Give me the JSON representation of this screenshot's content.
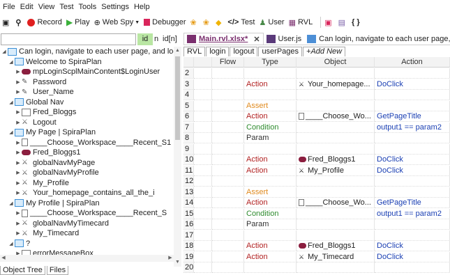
{
  "menu": [
    "File",
    "Edit",
    "View",
    "Test",
    "Tools",
    "Settings",
    "Help"
  ],
  "toolbar": {
    "record": "Record",
    "play": "Play",
    "webspy": "Web Spy",
    "debugger": "Debugger",
    "test": "Test",
    "user": "User",
    "rvl": "RVL",
    "braces": "{ }"
  },
  "left": {
    "search_value": "",
    "id_label": "id",
    "n_label": "n",
    "idn_label": "id[n]",
    "tabs": [
      "Object Tree",
      "Files"
    ]
  },
  "tree": [
    {
      "label": "Can login, navigate to each user page, and log",
      "indent": 0,
      "icon": "folder"
    },
    {
      "label": "Welcome to SpiraPlan",
      "indent": 1,
      "icon": "folder"
    },
    {
      "label": "mpLoginScplMainContent$LoginUser",
      "indent": 2,
      "icon": "pill"
    },
    {
      "label": "Password",
      "indent": 2,
      "icon": "edit"
    },
    {
      "label": "User_Name",
      "indent": 2,
      "icon": "edit"
    },
    {
      "label": "Global Nav",
      "indent": 1,
      "icon": "folder"
    },
    {
      "label": "Fred_Bloggs",
      "indent": 2,
      "icon": "table"
    },
    {
      "label": "Logout",
      "indent": 2,
      "icon": "link"
    },
    {
      "label": "My Page | SpiraPlan",
      "indent": 1,
      "icon": "folder"
    },
    {
      "label": "____Choose_Workspace____Recent_S1",
      "indent": 2,
      "icon": "doc"
    },
    {
      "label": "Fred_Bloggs1",
      "indent": 2,
      "icon": "pill"
    },
    {
      "label": "globalNavMyPage",
      "indent": 2,
      "icon": "link"
    },
    {
      "label": "globalNavMyProfile",
      "indent": 2,
      "icon": "link"
    },
    {
      "label": "My_Profile",
      "indent": 2,
      "icon": "link"
    },
    {
      "label": "Your_homepage_contains_all_the_i",
      "indent": 2,
      "icon": "link"
    },
    {
      "label": "My Profile | SpiraPlan",
      "indent": 1,
      "icon": "folder"
    },
    {
      "label": "____Choose_Workspace____Recent_S",
      "indent": 2,
      "icon": "doc"
    },
    {
      "label": "globalNavMyTimecard",
      "indent": 2,
      "icon": "link"
    },
    {
      "label": "My_Timecard",
      "indent": 2,
      "icon": "link"
    },
    {
      "label": "?",
      "indent": 1,
      "icon": "folder"
    },
    {
      "label": "errorMessageBox",
      "indent": 2,
      "icon": "table"
    }
  ],
  "doc_tabs": [
    {
      "label": "Main.rvl.xlsx*",
      "active": true,
      "icon": "xl"
    },
    {
      "label": "User.js",
      "active": false,
      "icon": "js"
    },
    {
      "label": "Can login, navigate to each user page, and lo",
      "active": false,
      "icon": "rvl"
    }
  ],
  "sheet_tabs": [
    "RVL",
    "login",
    "logout",
    "userPages",
    "+Add New"
  ],
  "columns": [
    "Flow",
    "Type",
    "Object",
    "Action"
  ],
  "rows": [
    {
      "n": "2",
      "type": "",
      "object": "",
      "action": ""
    },
    {
      "n": "3",
      "type": "Action",
      "object": "Your_homepage...",
      "action": "DoClick"
    },
    {
      "n": "4",
      "type": "",
      "object": "",
      "action": ""
    },
    {
      "n": "5",
      "type": "Assert",
      "object": "",
      "action": ""
    },
    {
      "n": "6",
      "type": "Action",
      "object": "____Choose_Wo...",
      "action": "GetPageTitle"
    },
    {
      "n": "7",
      "type": "Condition",
      "object": "",
      "action": "output1 == param2"
    },
    {
      "n": "8",
      "type": "Param",
      "object": "",
      "action": ""
    },
    {
      "n": "9",
      "type": "",
      "object": "",
      "action": ""
    },
    {
      "n": "10",
      "type": "Action",
      "object": "Fred_Bloggs1",
      "action": "DoClick"
    },
    {
      "n": "11",
      "type": "Action",
      "object": "My_Profile",
      "action": "DoClick"
    },
    {
      "n": "12",
      "type": "",
      "object": "",
      "action": ""
    },
    {
      "n": "13",
      "type": "Assert",
      "object": "",
      "action": ""
    },
    {
      "n": "14",
      "type": "Action",
      "object": "____Choose_Wo...",
      "action": "GetPageTitle"
    },
    {
      "n": "15",
      "type": "Condition",
      "object": "",
      "action": "output1 == param2"
    },
    {
      "n": "16",
      "type": "Param",
      "object": "",
      "action": ""
    },
    {
      "n": "17",
      "type": "",
      "object": "",
      "action": ""
    },
    {
      "n": "18",
      "type": "Action",
      "object": "Fred_Bloggs1",
      "action": "DoClick"
    },
    {
      "n": "19",
      "type": "Action",
      "object": "My_Timecard",
      "action": "DoClick"
    },
    {
      "n": "20",
      "type": "",
      "object": "",
      "action": ""
    }
  ],
  "row_object_icons": {
    "3": "link",
    "6": "doc",
    "10": "pill",
    "11": "link",
    "14": "doc",
    "18": "pill",
    "19": "link"
  }
}
